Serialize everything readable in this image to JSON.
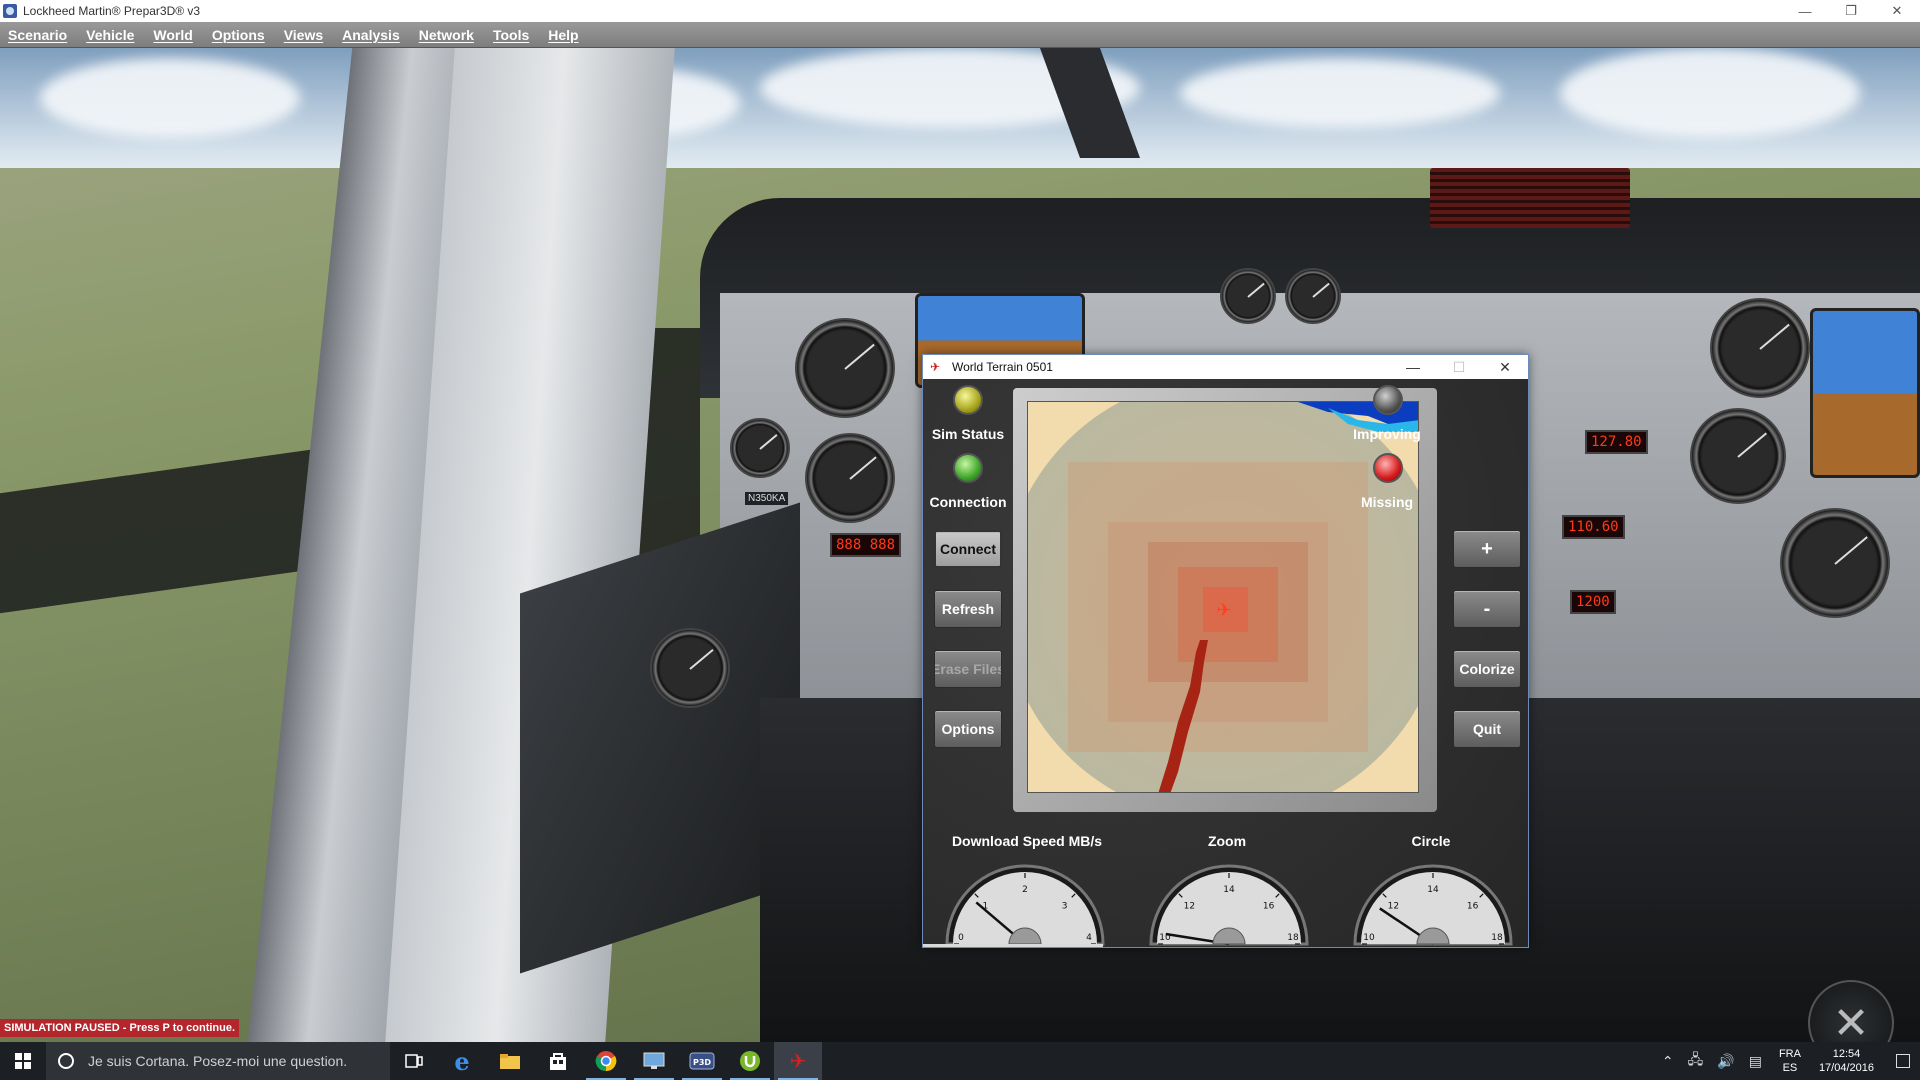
{
  "window": {
    "title": "Lockheed Martin® Prepar3D® v3",
    "minimize": "—",
    "maximize": "❐",
    "close": "✕"
  },
  "menu": [
    "Scenario",
    "Vehicle",
    "World",
    "Options",
    "Views",
    "Analysis",
    "Network",
    "Tools",
    "Help"
  ],
  "cockpit": {
    "tail_number": "N350KA",
    "com1": "127.80",
    "nav1": "110.60",
    "adf": "1200",
    "pause_banner": "SIMULATION PAUSED - Press P to continue."
  },
  "world_terrain": {
    "title": "World Terrain 0501",
    "minimize": "—",
    "maximize": "☐",
    "close": "✕",
    "sim_status_label": "Sim Status",
    "connection_label": "Connection",
    "improving_label": "Improving",
    "missing_label": "Missing",
    "buttons": {
      "connect": "Connect",
      "refresh": "Refresh",
      "erase_files": "Erase Files",
      "options": "Options",
      "plus": "+",
      "minus": "-",
      "colorize": "Colorize",
      "quit": "Quit"
    },
    "dials": [
      {
        "label": "Download Speed MB/s",
        "min": "0",
        "mid_low": "1",
        "mid": "2",
        "mid_high": "3",
        "max": "4",
        "value": 0.9,
        "range": [
          0,
          4
        ]
      },
      {
        "label": "Zoom",
        "min": "10",
        "mid_low": "12",
        "mid": "14",
        "mid_high": "16",
        "max": "18",
        "value": 10.4,
        "range": [
          10,
          18
        ]
      },
      {
        "label": "Circle",
        "min": "10",
        "mid_low": "12",
        "mid": "14",
        "mid_high": "16",
        "max": "18",
        "value": 11.5,
        "range": [
          10,
          18
        ]
      }
    ],
    "colors": {
      "sim_status": "#c8c726",
      "connection": "#3fa52b",
      "improving": "#555555",
      "missing": "#d51a1a"
    }
  },
  "taskbar": {
    "cortana_placeholder": "Je suis Cortana. Posez-moi une question.",
    "language": "FRA",
    "keyboard": "ES",
    "time": "12:54",
    "date": "17/04/2016"
  }
}
